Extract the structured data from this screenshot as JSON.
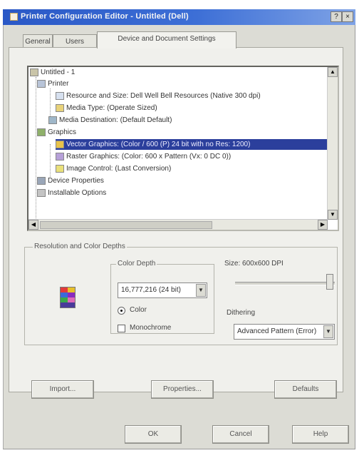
{
  "window": {
    "title": "Printer Configuration Editor - Untitled (Dell)",
    "minimize_glyph": "?",
    "close_glyph": "×"
  },
  "tabs": [
    {
      "label": "General"
    },
    {
      "label": "Users"
    },
    {
      "label": "Device and Document Settings"
    }
  ],
  "tree": {
    "items": [
      "Untitled - 1",
      "Printer",
      "Resource and Size: Dell Well Bell Resources (Native 300 dpi)",
      "Media Type: (Operate Sized)",
      "Media Destination: (Default Default)",
      "Graphics",
      "Vector Graphics: (Color / 600 (P) 24 bit with no Res: 1200)",
      "Raster Graphics: (Color: 600 x Pattern (Vx: 0 DC 0))",
      "Image Control: (Last Conversion)",
      "Device Properties",
      "Installable Options"
    ],
    "selected_index": 6
  },
  "resolution_group": {
    "label": "Resolution and Color Depths",
    "color_depth": {
      "label": "Color Depth",
      "selected": "16,777,216 (24 bit)"
    },
    "color_radio": "Color",
    "monochrome_checkbox": "Monochrome",
    "size_label": "Size: 600x600 DPI",
    "dithering_label": "Dithering",
    "dithering_value": "Advanced Pattern (Error)"
  },
  "buttons": {
    "import": "Import...",
    "properties": "Properties...",
    "defaults": "Defaults",
    "ok": "OK",
    "cancel": "Cancel",
    "help": "Help"
  },
  "colors": {
    "titlebar": "#2a58c6",
    "selection": "#2b3f9c",
    "panel": "#f0f0ec"
  }
}
